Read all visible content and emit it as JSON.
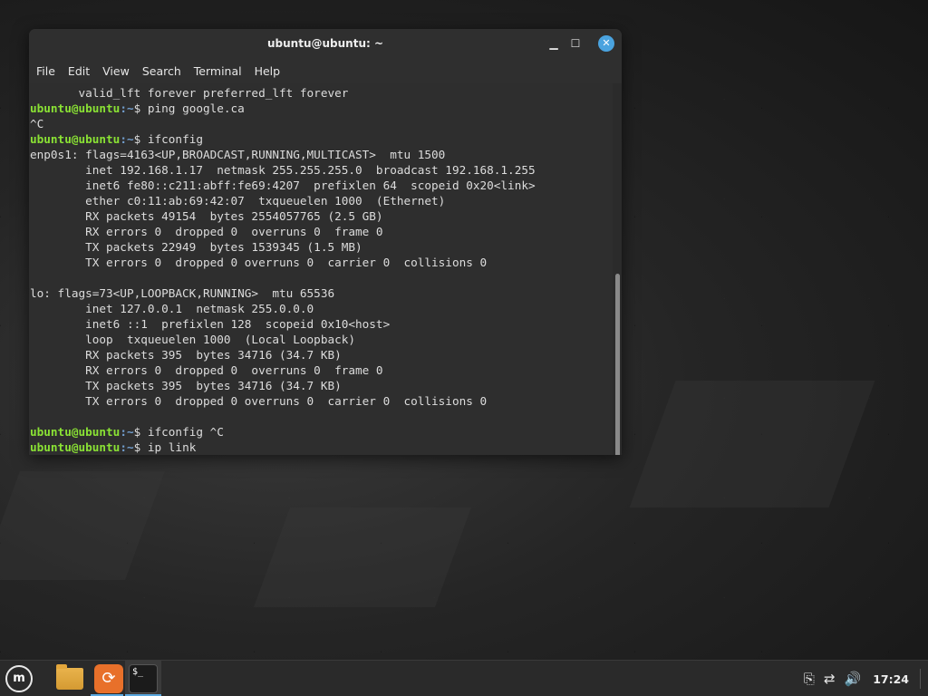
{
  "window": {
    "title": "ubuntu@ubuntu: ~"
  },
  "menu": {
    "items": [
      "File",
      "Edit",
      "View",
      "Search",
      "Terminal",
      "Help"
    ]
  },
  "terminal": {
    "lines": [
      {
        "prefix": "",
        "path": "",
        "text": "       valid_lft forever preferred_lft forever"
      },
      {
        "prefix": "ubuntu@ubuntu",
        "path": ":~",
        "text": "$ ping google.ca"
      },
      {
        "prefix": "",
        "path": "",
        "text": "^C"
      },
      {
        "prefix": "ubuntu@ubuntu",
        "path": ":~",
        "text": "$ ifconfig"
      },
      {
        "prefix": "",
        "path": "",
        "text": "enp0s1: flags=4163<UP,BROADCAST,RUNNING,MULTICAST>  mtu 1500"
      },
      {
        "prefix": "",
        "path": "",
        "text": "        inet 192.168.1.17  netmask 255.255.255.0  broadcast 192.168.1.255"
      },
      {
        "prefix": "",
        "path": "",
        "text": "        inet6 fe80::c211:abff:fe69:4207  prefixlen 64  scopeid 0x20<link>"
      },
      {
        "prefix": "",
        "path": "",
        "text": "        ether c0:11:ab:69:42:07  txqueuelen 1000  (Ethernet)"
      },
      {
        "prefix": "",
        "path": "",
        "text": "        RX packets 49154  bytes 2554057765 (2.5 GB)"
      },
      {
        "prefix": "",
        "path": "",
        "text": "        RX errors 0  dropped 0  overruns 0  frame 0"
      },
      {
        "prefix": "",
        "path": "",
        "text": "        TX packets 22949  bytes 1539345 (1.5 MB)"
      },
      {
        "prefix": "",
        "path": "",
        "text": "        TX errors 0  dropped 0 overruns 0  carrier 0  collisions 0"
      },
      {
        "prefix": "",
        "path": "",
        "text": ""
      },
      {
        "prefix": "",
        "path": "",
        "text": "lo: flags=73<UP,LOOPBACK,RUNNING>  mtu 65536"
      },
      {
        "prefix": "",
        "path": "",
        "text": "        inet 127.0.0.1  netmask 255.0.0.0"
      },
      {
        "prefix": "",
        "path": "",
        "text": "        inet6 ::1  prefixlen 128  scopeid 0x10<host>"
      },
      {
        "prefix": "",
        "path": "",
        "text": "        loop  txqueuelen 1000  (Local Loopback)"
      },
      {
        "prefix": "",
        "path": "",
        "text": "        RX packets 395  bytes 34716 (34.7 KB)"
      },
      {
        "prefix": "",
        "path": "",
        "text": "        RX errors 0  dropped 0  overruns 0  frame 0"
      },
      {
        "prefix": "",
        "path": "",
        "text": "        TX packets 395  bytes 34716 (34.7 KB)"
      },
      {
        "prefix": "",
        "path": "",
        "text": "        TX errors 0  dropped 0 overruns 0  carrier 0  collisions 0"
      },
      {
        "prefix": "",
        "path": "",
        "text": ""
      },
      {
        "prefix": "ubuntu@ubuntu",
        "path": ":~",
        "text": "$ ifconfig ^C"
      },
      {
        "prefix": "ubuntu@ubuntu",
        "path": ":~",
        "text": "$ ip link"
      }
    ]
  },
  "taskbar": {
    "apps": [
      {
        "name": "menu",
        "icon": "mint-logo-icon"
      },
      {
        "name": "files",
        "icon": "folder-icon"
      },
      {
        "name": "update-manager",
        "icon": "update-icon"
      },
      {
        "name": "terminal",
        "icon": "terminal-icon",
        "glyph": "$_"
      }
    ],
    "tray": {
      "clipboard_glyph": "⎘",
      "network_glyph": "⇄",
      "volume_glyph": "🔊",
      "clock": "17:24"
    }
  },
  "colors": {
    "prompt_user": "#8ae234",
    "prompt_path": "#729fcf",
    "accent": "#4aa3df",
    "terminal_bg": "#2e2e2e"
  }
}
